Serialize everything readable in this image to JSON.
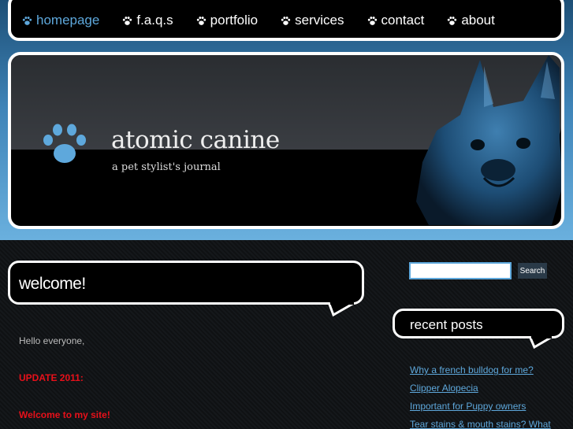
{
  "nav": {
    "items": [
      {
        "label": "homepage",
        "active": true
      },
      {
        "label": "f.a.q.s",
        "active": false
      },
      {
        "label": "portfolio",
        "active": false
      },
      {
        "label": "services",
        "active": false
      },
      {
        "label": "contact",
        "active": false
      },
      {
        "label": "about",
        "active": false
      }
    ]
  },
  "header": {
    "title": "atomic canine",
    "tagline": "a pet stylist's journal"
  },
  "main": {
    "welcome_title": "welcome!",
    "paragraphs": [
      "Hello everyone,",
      "UPDATE 2011:",
      "Welcome to my site!"
    ]
  },
  "sidebar": {
    "search_value": "",
    "search_button": "Search",
    "recent_title": "recent posts",
    "posts": [
      "Why a french bulldog for me?",
      "Clipper Alopecia",
      "Important for Puppy owners",
      "Tear stains & mouth stains? What"
    ]
  },
  "colors": {
    "accent": "#5ea8dc",
    "highlight": "#e8101a",
    "banner_top": "#1d4f76",
    "banner_bottom": "#6ab0de"
  }
}
